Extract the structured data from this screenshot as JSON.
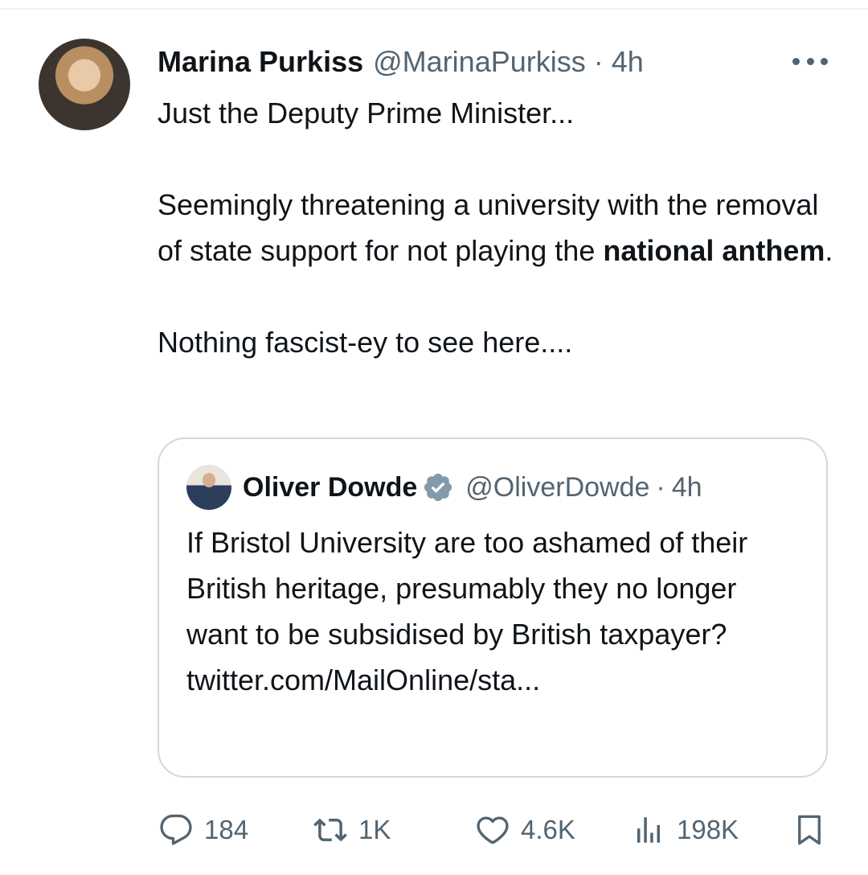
{
  "tweet": {
    "author": {
      "display_name": "Marina Purkiss",
      "handle": "@MarinaPurkiss",
      "separator": "·",
      "time": "4h"
    },
    "more_icon": "more-horizontal-icon",
    "text": {
      "line1": "Just the Deputy Prime Minister...",
      "para2_part1": "Seemingly threatening a university with the removal of state support for not playing the ",
      "para2_bold": "national anthem",
      "para2_end": ".",
      "para3": "Nothing fascist-ey to see here...."
    },
    "quote": {
      "display_name": "Oliver Dowde",
      "verified_icon": "verified-badge-icon",
      "handle": "@OliverDowde",
      "separator": "·",
      "time": "4h",
      "text": "If Bristol University are too ashamed of their British heritage, presumably they no longer want to be subsidised by British taxpayer? twitter.com/MailOnline/sta..."
    },
    "actions": {
      "reply_count": "184",
      "retweet_count": "1K",
      "like_count": "4.6K",
      "views_count": "198K",
      "icons": [
        "reply-icon",
        "retweet-icon",
        "like-icon",
        "views-icon",
        "bookmark-icon"
      ]
    }
  },
  "colors": {
    "text": "#0f1419",
    "secondary": "#536471",
    "border": "#cfd9de",
    "verified": "#829aab"
  }
}
